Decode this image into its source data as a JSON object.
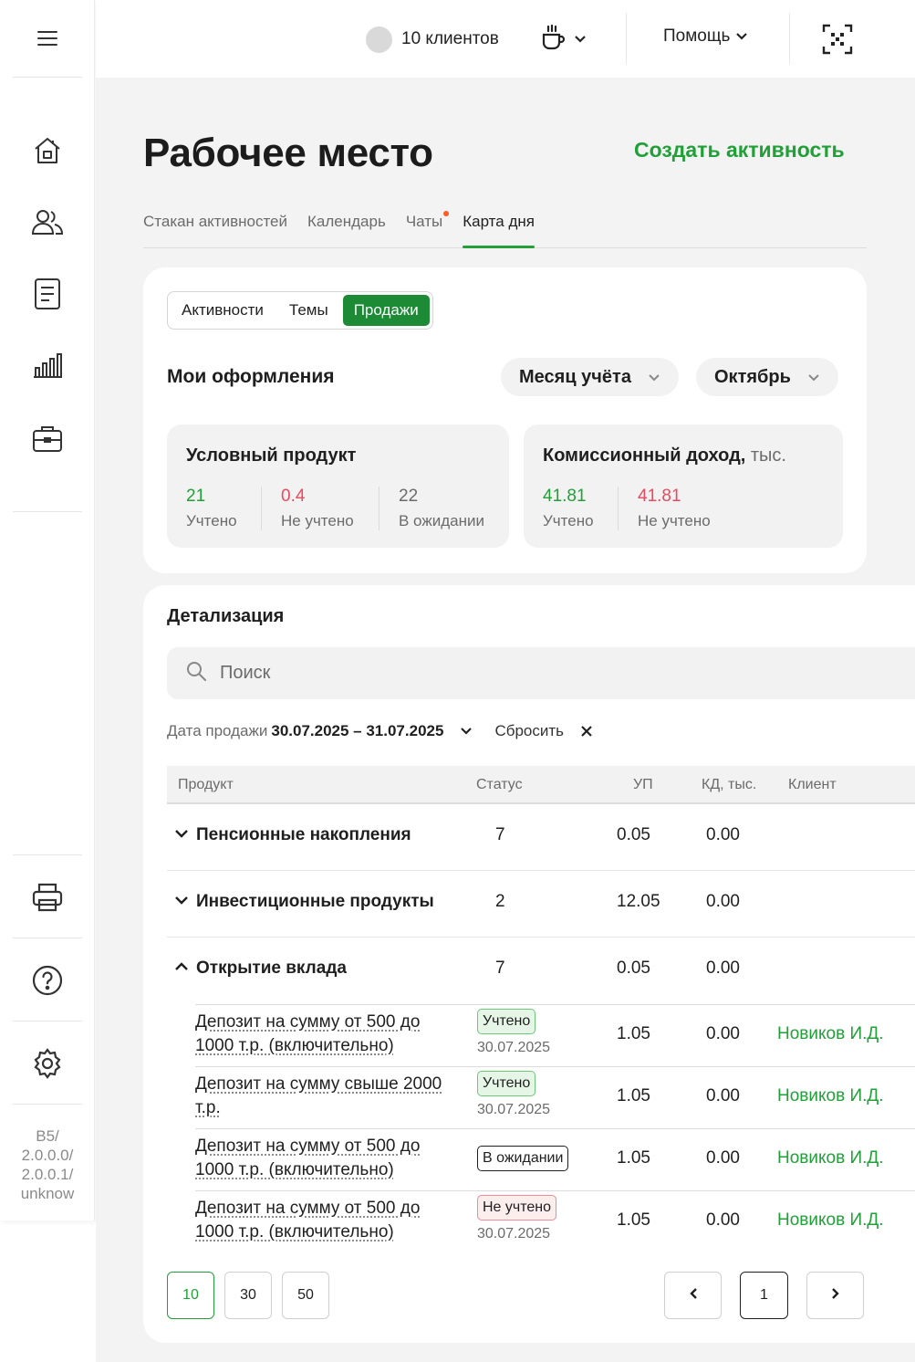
{
  "topbar": {
    "clients_label": "10 клиентов",
    "help_label": "Помощь"
  },
  "sidebar": {
    "version": "B5/\n2.0.0.0/\n2.0.0.1/\nunknow"
  },
  "page": {
    "title": "Рабочее место",
    "create_label": "Создать активность",
    "tabs": [
      {
        "label": "Стакан активностей"
      },
      {
        "label": "Календарь"
      },
      {
        "label": "Чаты"
      },
      {
        "label": "Карта дня"
      }
    ]
  },
  "summary": {
    "segments": [
      "Активности",
      "Темы",
      "Продажи"
    ],
    "title": "Мои оформления",
    "period_type": "Месяц учёта",
    "month": "Октябрь",
    "product_card": {
      "title": "Условный продукт",
      "stats": [
        {
          "value": "21",
          "label": "Учтено"
        },
        {
          "value": "0.4",
          "label": "Не учтено"
        },
        {
          "value": "22",
          "label": "В ожидании"
        }
      ]
    },
    "income_card": {
      "title": "Комиссионный доход,",
      "unit": " тыс.",
      "stats": [
        {
          "value": "41.81",
          "label": "Учтено"
        },
        {
          "value": "41.81",
          "label": "Не учтено"
        }
      ]
    }
  },
  "details": {
    "title": "Детализация",
    "search_placeholder": "Поиск",
    "filter_label": "Дата продажи",
    "filter_value": "30.07.2025 – 31.07.2025",
    "reset_label": "Сбросить",
    "columns": [
      "Продукт",
      "Статус",
      "УП",
      "КД, тыс.",
      "Клиент"
    ],
    "groups": [
      {
        "name": "Пенсионные накопления",
        "count": "7",
        "up": "0.05",
        "kd": "0.00"
      },
      {
        "name": "Инвестиционные продукты",
        "count": "2",
        "up": "12.05",
        "kd": "0.00"
      },
      {
        "name": "Открытие вклада",
        "count": "7",
        "up": "0.05",
        "kd": "0.00"
      }
    ],
    "items": [
      {
        "name": "Депозит на сумму от 500 до 1000 т.р. (включительно)",
        "status": "Учтено",
        "date": "30.07.2025",
        "up": "1.05",
        "kd": "0.00",
        "client": "Новиков И.Д."
      },
      {
        "name": "Депозит на сумму свыше 2000 т.р.",
        "status": "Учтено",
        "date": "30.07.2025",
        "up": "1.05",
        "kd": "0.00",
        "client": "Новиков И.Д."
      },
      {
        "name": "Депозит на сумму от 500 до 1000 т.р. (включительно)",
        "status": "В ожидании",
        "date": "",
        "up": "1.05",
        "kd": "0.00",
        "client": "Новиков И.Д."
      },
      {
        "name": "Депозит на сумму от 500 до 1000 т.р. (включительно)",
        "status": "Не учтено",
        "date": "30.07.2025",
        "up": "1.05",
        "kd": "0.00",
        "client": "Новиков И.Д."
      }
    ],
    "page_sizes": [
      "10",
      "30",
      "50"
    ],
    "current_page": "1"
  },
  "colors": {
    "accent": "#21a038",
    "danger": "#e94a5f",
    "background": "#f3f3f3"
  },
  "icons": [
    "menu-icon",
    "home-icon",
    "users-icon",
    "document-icon",
    "chart-icon",
    "briefcase-icon",
    "printer-icon",
    "help-icon",
    "settings-icon",
    "coffee-icon",
    "qr-scan-icon",
    "search-icon",
    "chevron-down-icon",
    "chevron-up-icon",
    "close-icon",
    "chevron-left-icon",
    "chevron-right-icon"
  ]
}
